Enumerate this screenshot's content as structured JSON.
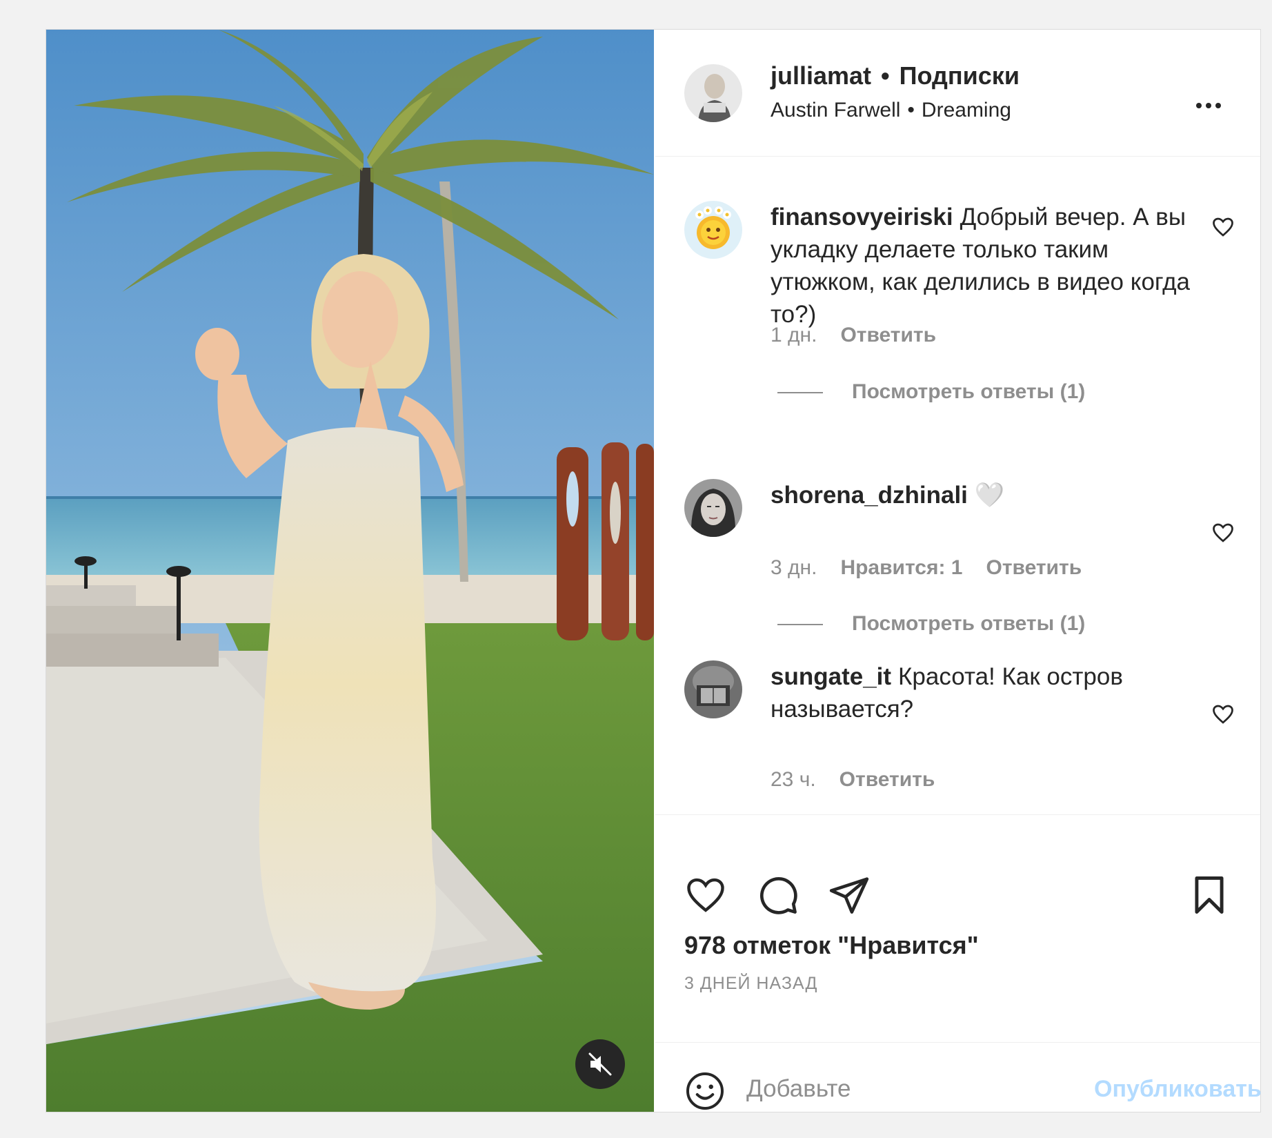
{
  "header": {
    "username": "julliamat",
    "separator": "•",
    "follow_status": "Подписки",
    "music_artist": "Austin Farwell",
    "music_track": "Dreaming",
    "more_icon": "more-horizontal-icon"
  },
  "comments": [
    {
      "username": "finansovyeiriski",
      "text": "Добрый вечер. А вы укладку делаете только таким утюжком, как делились в видео когда то?)",
      "time": "1 дн.",
      "likes": "",
      "reply": "Ответить",
      "view_replies": "Посмотреть ответы (1)"
    },
    {
      "username": "shorena_dzhinali",
      "text": "🤍",
      "time": "3 дн.",
      "likes": "Нравится: 1",
      "reply": "Ответить",
      "view_replies": "Посмотреть ответы (1)"
    },
    {
      "username": "sungate_it",
      "text": "Красота! Как остров называется?",
      "time": "23 ч.",
      "likes": "",
      "reply": "Ответить",
      "view_replies": ""
    }
  ],
  "actions": {
    "like_icon": "heart-icon",
    "comment_icon": "comment-icon",
    "share_icon": "paper-plane-icon",
    "save_icon": "bookmark-icon"
  },
  "likes_text": "978 отметок \"Нравится\"",
  "date_text": "3 ДНЕЙ НАЗАД",
  "add_comment": {
    "placeholder": "Добавьте",
    "post_label": "Опубликовать",
    "post_color": "#b3dbff"
  },
  "colors": {
    "text": "#262626",
    "secondary": "#8e8e8e",
    "border": "#dbdbdb"
  }
}
